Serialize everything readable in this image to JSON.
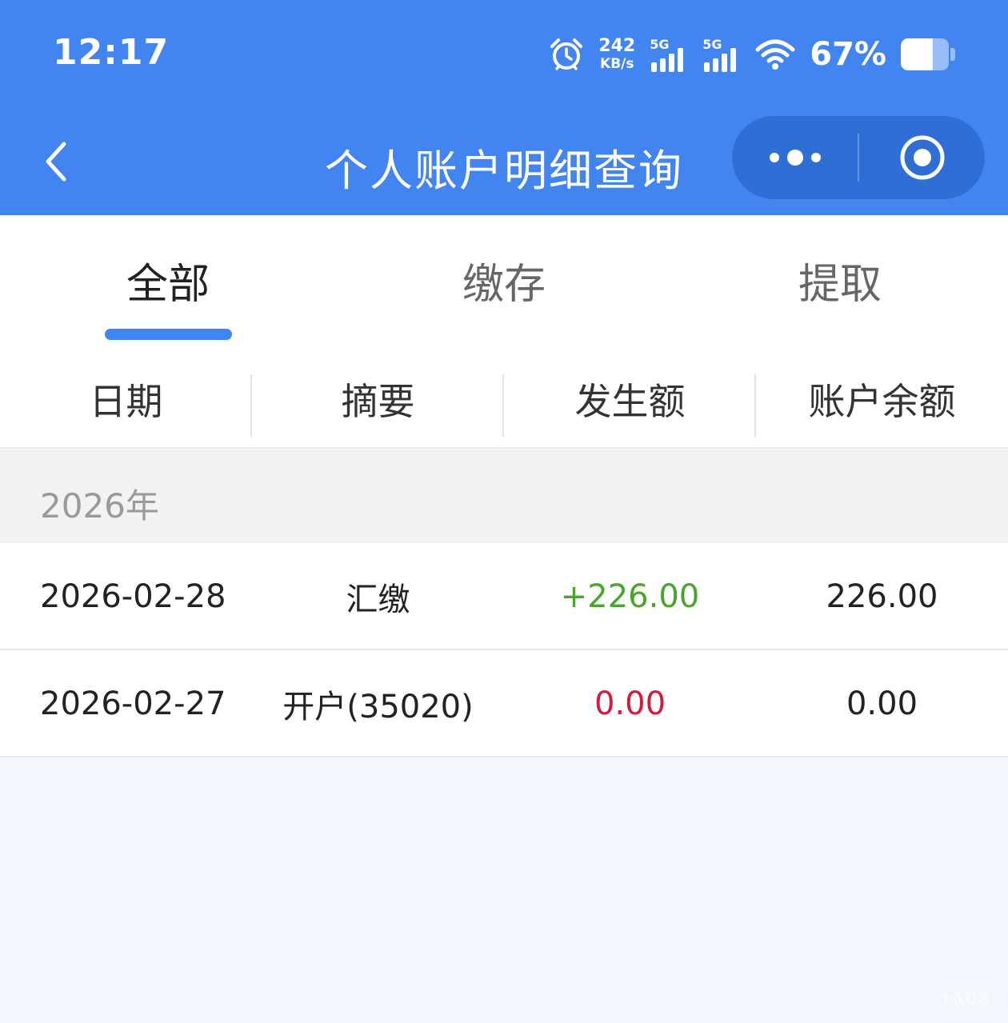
{
  "status_bar": {
    "time": "12:17",
    "net_speed_value": "242",
    "net_speed_unit": "KB/s",
    "sim1_tag": "5G",
    "sim2_tag": "5G",
    "battery_percent": "67%",
    "battery_level": 0.67
  },
  "nav": {
    "title": "个人账户明细查询"
  },
  "tabs": {
    "items": [
      {
        "label": "全部"
      },
      {
        "label": "缴存"
      },
      {
        "label": "提取"
      }
    ],
    "active_index": 0
  },
  "table": {
    "headers": [
      "日期",
      "摘要",
      "发生额",
      "账户余额"
    ],
    "year_label": "2026年",
    "rows": [
      {
        "date": "2026-02-28",
        "summary": "汇缴",
        "amount": "+226.00",
        "balance": "226.00",
        "amount_color": "#4aa52e"
      },
      {
        "date": "2026-02-27",
        "summary": "开户(35020)",
        "amount": "0.00",
        "balance": "0.00",
        "amount_color": "#d7193a"
      }
    ]
  },
  "watermark": "卡农社区",
  "colors": {
    "brand": "#4385f0",
    "capsule": "#2f6fd5",
    "tab_indicator": "#3d86f4",
    "positive": "#4aa52e",
    "negative": "#d7193a"
  },
  "icons": {
    "back": "chevron-left-icon",
    "more": "more-dots-icon",
    "close": "target-circle-icon",
    "alarm": "alarm-clock-icon",
    "wifi": "wifi-icon",
    "battery": "battery-icon"
  }
}
